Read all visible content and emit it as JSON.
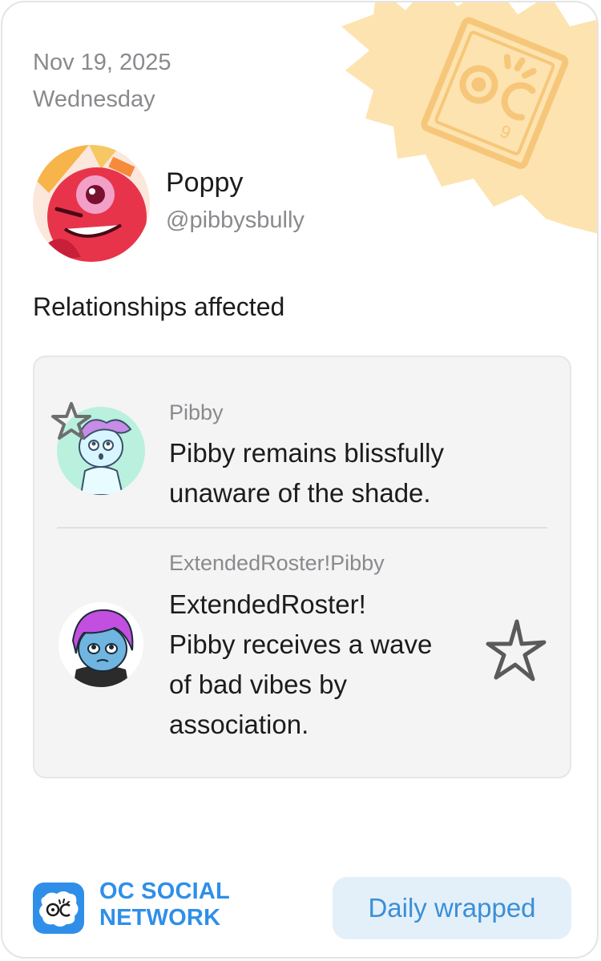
{
  "date": {
    "line1": "Nov 19, 2025",
    "line2": "Wednesday"
  },
  "user": {
    "name": "Poppy",
    "handle": "@pibbysbully"
  },
  "section_title": "Relationships affected",
  "relationships": [
    {
      "name": "Pibby",
      "text_lines": [
        "Pibby remains blissfully",
        "unaware of the shade."
      ]
    },
    {
      "name": "ExtendedRoster!Pibby",
      "text_lines": [
        "ExtendedRoster!",
        "Pibby receives a wave",
        "of bad vibes by",
        "association."
      ]
    }
  ],
  "brand": {
    "line1": "OC SOCIAL",
    "line2": "NETWORK"
  },
  "footer": {
    "button_label": "Daily wrapped"
  },
  "colors": {
    "accent": "#2f8fe8",
    "badge": "#fde3b0",
    "button_bg": "#e3f0fa"
  }
}
